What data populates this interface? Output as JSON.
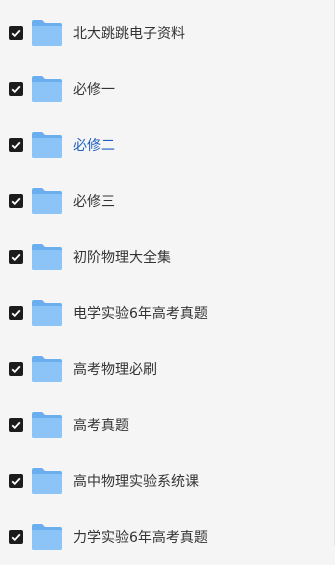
{
  "folders": [
    {
      "label": "北大跳跳电子资料",
      "checked": true,
      "active": false
    },
    {
      "label": "必修一",
      "checked": true,
      "active": false
    },
    {
      "label": "必修二",
      "checked": true,
      "active": true
    },
    {
      "label": "必修三",
      "checked": true,
      "active": false
    },
    {
      "label": "初阶物理大全集",
      "checked": true,
      "active": false
    },
    {
      "label": "电学实验6年高考真题",
      "checked": true,
      "active": false
    },
    {
      "label": "高考物理必刷",
      "checked": true,
      "active": false
    },
    {
      "label": "高考真题",
      "checked": true,
      "active": false
    },
    {
      "label": "高中物理实验系统课",
      "checked": true,
      "active": false
    },
    {
      "label": "力学实验6年高考真题",
      "checked": true,
      "active": false
    }
  ],
  "colors": {
    "background": "#f5f5f6",
    "text": "#333333",
    "active_text": "#1e5fbf",
    "checkbox": "#1c1c1c",
    "folder_front": "#8cc4f7",
    "folder_back": "#6aaef0"
  },
  "icons": {
    "checkbox": "checkbox-checked-icon",
    "folder": "folder-icon"
  }
}
